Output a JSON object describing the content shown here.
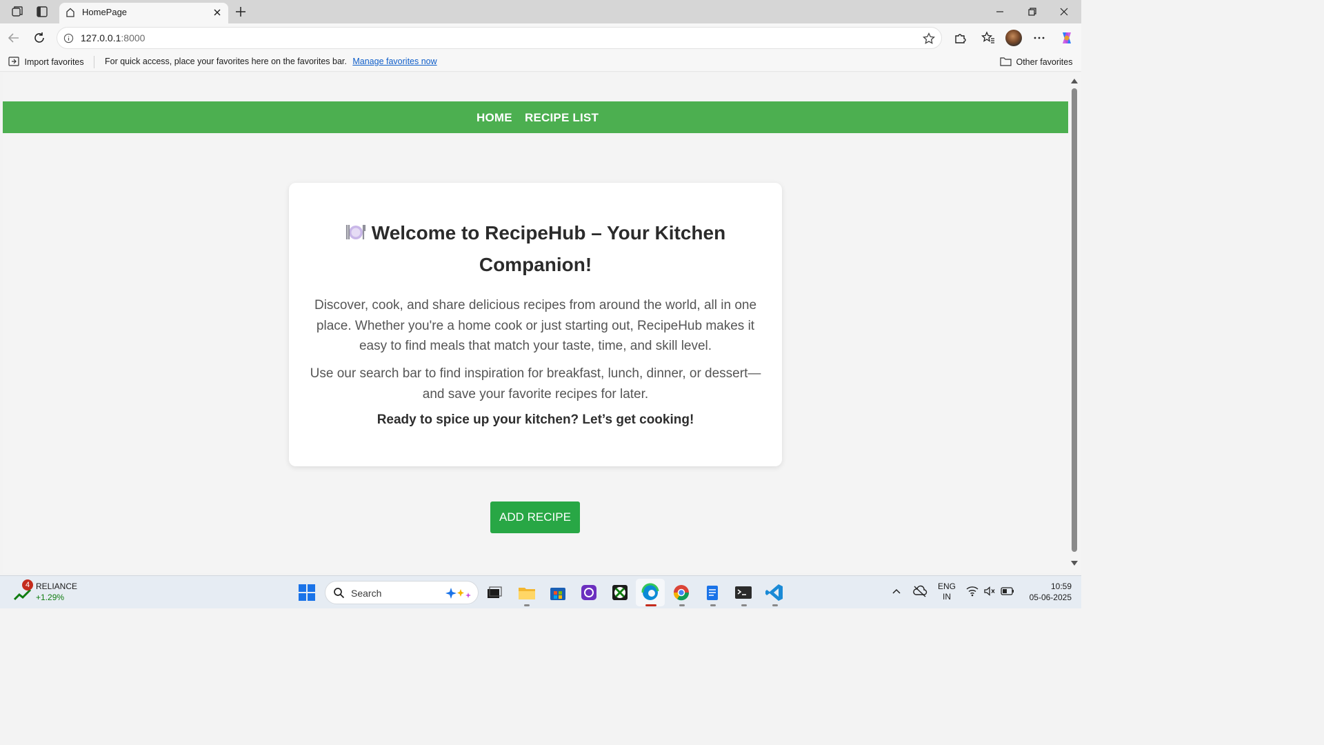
{
  "browser": {
    "tab_title": "HomePage",
    "url_host": "127.0.0.1",
    "url_port": ":8000"
  },
  "favorites_bar": {
    "import_label": "Import favorites",
    "message": "For quick access, place your favorites here on the favorites bar.",
    "manage_link": "Manage favorites now",
    "other_label": "Other favorites"
  },
  "page": {
    "nav": {
      "home": "HOME",
      "recipe_list": "RECIPE LIST"
    },
    "card": {
      "title": "Welcome to RecipeHub – Your Kitchen Companion!",
      "paragraph1": "Discover, cook, and share delicious recipes from around the world, all in one place. Whether you're a home cook or just starting out, RecipeHub makes it easy to find meals that match your taste, time, and skill level.",
      "paragraph2": "Use our search bar to find inspiration for breakfast, lunch, dinner, or dessert— and save your favorite recipes for later.",
      "tagline": "Ready to spice up your kitchen? Let’s get cooking!"
    },
    "add_button": "ADD RECIPE"
  },
  "taskbar": {
    "stock_name": "RELIANCE",
    "stock_change": "+1.29%",
    "stock_badge": "4",
    "search_placeholder": "Search",
    "language_line1": "ENG",
    "language_line2": "IN",
    "time": "10:59",
    "date": "05-06-2025"
  },
  "colors": {
    "nav_green": "#4caf50",
    "button_green": "#28a745",
    "link_blue": "#0f5ec9"
  }
}
